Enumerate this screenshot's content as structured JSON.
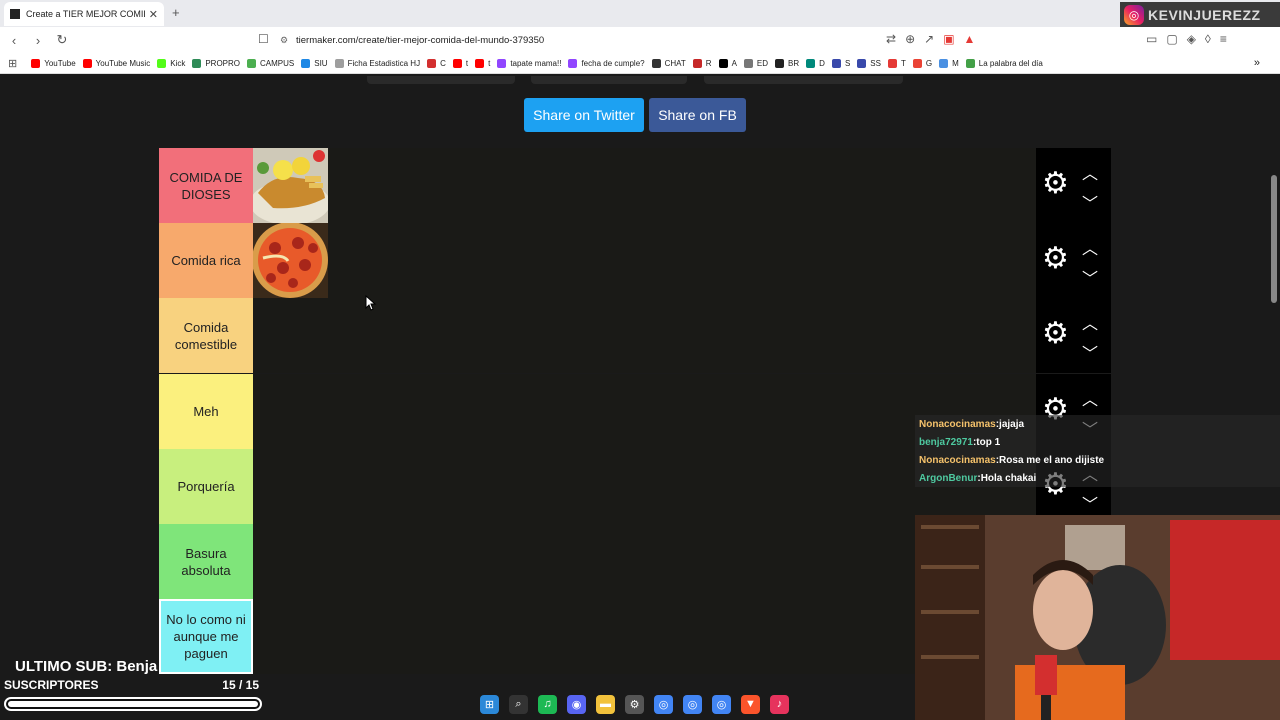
{
  "browser": {
    "tab_title": "Create a TIER MEJOR COMIDA D",
    "tab_close": "✕",
    "new_tab": "+",
    "url": "tiermaker.com/create/tier-mejor-comida-del-mundo-379350",
    "instagram_handle": "KEVINJUEREZZ"
  },
  "bookmarks": [
    {
      "label": "YouTube",
      "color": "#ff0000"
    },
    {
      "label": "YouTube Music",
      "color": "#ff0000"
    },
    {
      "label": "Kick",
      "color": "#53fc18"
    },
    {
      "label": "PROPRO",
      "color": "#2e8b57"
    },
    {
      "label": "CAMPUS",
      "color": "#4caf50"
    },
    {
      "label": "SIU",
      "color": "#1e88e5"
    },
    {
      "label": "Ficha Estadistica HJ",
      "color": "#9e9e9e"
    },
    {
      "label": "C",
      "color": "#d32f2f"
    },
    {
      "label": "t",
      "color": "#ff0000"
    },
    {
      "label": "t",
      "color": "#ff0000"
    },
    {
      "label": "tapate mama!!",
      "color": "#9146ff"
    },
    {
      "label": "fecha de cumple?",
      "color": "#9146ff"
    },
    {
      "label": "CHAT",
      "color": "#333333"
    },
    {
      "label": "R",
      "color": "#c62828"
    },
    {
      "label": "A",
      "color": "#000000"
    },
    {
      "label": "ED",
      "color": "#777777"
    },
    {
      "label": "BR",
      "color": "#222222"
    },
    {
      "label": "D",
      "color": "#00897b"
    },
    {
      "label": "S",
      "color": "#3949ab"
    },
    {
      "label": "SS",
      "color": "#3949ab"
    },
    {
      "label": "T",
      "color": "#e53935"
    },
    {
      "label": "G",
      "color": "#ea4335"
    },
    {
      "label": "M",
      "color": "#4a90e2"
    },
    {
      "label": "La palabra del día",
      "color": "#43a047"
    }
  ],
  "share": {
    "twitter": "Share on Twitter",
    "facebook": "Share on FB"
  },
  "tiers": [
    {
      "label": "COMIDA DE DIOSES",
      "color": "#f26f7a",
      "items": [
        "milanesa-icon"
      ]
    },
    {
      "label": "Comida rica",
      "color": "#f7a96c",
      "items": [
        "pizza-icon"
      ]
    },
    {
      "label": "Comida comestible",
      "color": "#f8d27f",
      "items": []
    },
    {
      "label": "Meh",
      "color": "#fbf07e",
      "items": []
    },
    {
      "label": "Porquería",
      "color": "#c8ef7e",
      "items": []
    },
    {
      "label": "Basura absoluta",
      "color": "#7fe57a",
      "items": []
    },
    {
      "label": "No lo como ni aunque me paguen",
      "color": "#7ff0f4",
      "items": []
    }
  ],
  "chat": [
    {
      "user": "Nonacocinamas",
      "msg": "jajaja",
      "style": "u1"
    },
    {
      "user": "benja72971",
      "msg": "top 1",
      "style": "u2"
    },
    {
      "user": "Nonacocinamas",
      "msg": "Rosa me el ano dijiste",
      "style": "u1"
    },
    {
      "user": "ArgonBenur",
      "msg": "Hola chakai",
      "style": "u2"
    }
  ],
  "overlay": {
    "last_sub": "ULTIMO SUB: Benja",
    "subs_label": "SUSCRIPTORES",
    "subs_count": "15  / 15",
    "subs_progress": 1.0
  },
  "taskbar": [
    "windows-icon",
    "search-icon",
    "spotify-icon",
    "discord-icon",
    "folder-icon",
    "settings-icon",
    "chrome-icon",
    "chrome-icon",
    "chrome-icon",
    "brave-icon",
    "tiktok-icon"
  ]
}
